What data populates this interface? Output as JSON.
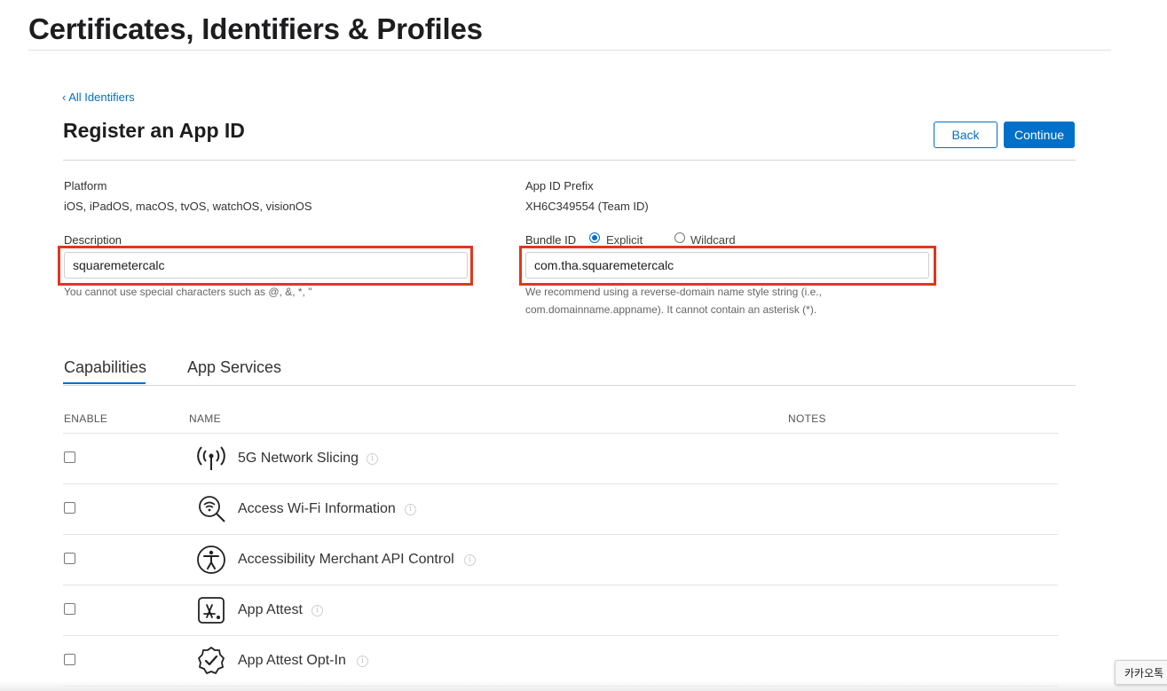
{
  "header": {
    "title": "Certificates, Identifiers & Profiles"
  },
  "breadcrumb": {
    "back_label": "‹ All Identifiers"
  },
  "section": {
    "title": "Register an App ID"
  },
  "actions": {
    "back_label": "Back",
    "continue_label": "Continue"
  },
  "platform": {
    "label": "Platform",
    "value": "iOS, iPadOS, macOS, tvOS, watchOS, visionOS"
  },
  "prefix": {
    "label": "App ID Prefix",
    "value": "XH6C349554 (Team ID)"
  },
  "description": {
    "label": "Description",
    "value": "squaremetercalc",
    "hint": "You cannot use special characters such as @, &, *, \""
  },
  "bundle_id": {
    "label": "Bundle ID",
    "options": [
      {
        "label": "Explicit",
        "selected": true
      },
      {
        "label": "Wildcard",
        "selected": false
      }
    ],
    "value": "com.tha.squaremetercalc",
    "hint_line1": "We recommend using a reverse-domain name style string (i.e.,",
    "hint_line2": "com.domainname.appname). It cannot contain an asterisk (*)."
  },
  "tabs": [
    {
      "label": "Capabilities",
      "active": true
    },
    {
      "label": "App Services",
      "active": false
    }
  ],
  "table": {
    "headers": {
      "enable": "ENABLE",
      "name": "NAME",
      "notes": "NOTES"
    },
    "rows": [
      {
        "name": "5G Network Slicing",
        "icon": "antenna-icon",
        "enabled": false
      },
      {
        "name": "Access Wi-Fi Information",
        "icon": "wifi-search-icon",
        "enabled": false
      },
      {
        "name": "Accessibility Merchant API Control",
        "icon": "accessibility-icon",
        "enabled": false
      },
      {
        "name": "App Attest",
        "icon": "app-store-icon",
        "enabled": false
      },
      {
        "name": "App Attest Opt-In",
        "icon": "verified-badge-icon",
        "enabled": false
      }
    ]
  },
  "overlay": {
    "tooltip_text": "카카오톡"
  },
  "colors": {
    "accent": "#0070c9",
    "highlight": "#e2361c",
    "text": "#1d1d1f"
  }
}
